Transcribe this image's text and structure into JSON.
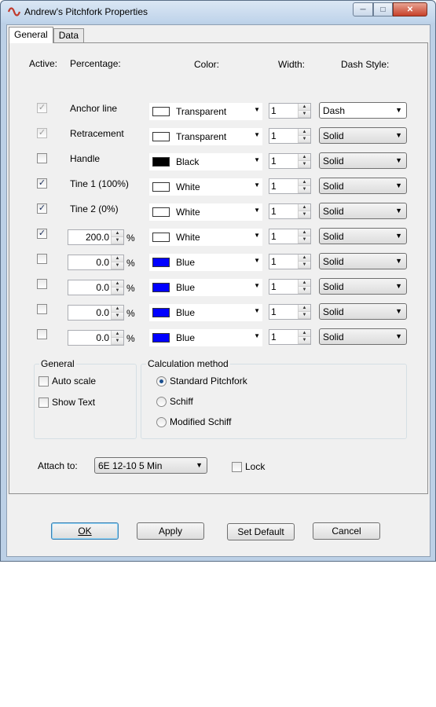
{
  "window": {
    "title": "Andrew's Pitchfork Properties",
    "app_icon": "ninjatrader-logo-icon"
  },
  "tabs": [
    {
      "label": "General",
      "active": true
    },
    {
      "label": "Data",
      "active": false
    }
  ],
  "headers": {
    "active": "Active:",
    "percentage": "Percentage:",
    "color": "Color:",
    "width": "Width:",
    "dash_style": "Dash Style:"
  },
  "rows": [
    {
      "active": true,
      "enabled": false,
      "name": "Anchor line",
      "color": "Transparent",
      "swatch": "#ffffff",
      "width": "1",
      "dash": "Dash"
    },
    {
      "active": true,
      "enabled": false,
      "name": "Retracement",
      "color": "Transparent",
      "swatch": "#ffffff",
      "width": "1",
      "dash": "Solid"
    },
    {
      "active": false,
      "enabled": true,
      "name": "Handle",
      "color": "Black",
      "swatch": "#000000",
      "width": "1",
      "dash": "Solid"
    },
    {
      "active": true,
      "enabled": true,
      "name": "Tine 1 (100%)",
      "color": "White",
      "swatch": "#ffffff",
      "width": "1",
      "dash": "Solid"
    },
    {
      "active": true,
      "enabled": true,
      "name": "Tine 2 (0%)",
      "color": "White",
      "swatch": "#ffffff",
      "width": "1",
      "dash": "Solid"
    },
    {
      "active": true,
      "enabled": true,
      "percent": "200.0",
      "pct_suffix": "%",
      "color": "White",
      "swatch": "#ffffff",
      "width": "1",
      "dash": "Solid"
    },
    {
      "active": false,
      "enabled": true,
      "percent": "0.0",
      "pct_suffix": "%",
      "color": "Blue",
      "swatch": "#0000ff",
      "width": "1",
      "dash": "Solid"
    },
    {
      "active": false,
      "enabled": true,
      "percent": "0.0",
      "pct_suffix": "%",
      "color": "Blue",
      "swatch": "#0000ff",
      "width": "1",
      "dash": "Solid"
    },
    {
      "active": false,
      "enabled": true,
      "percent": "0.0",
      "pct_suffix": "%",
      "color": "Blue",
      "swatch": "#0000ff",
      "width": "1",
      "dash": "Solid"
    },
    {
      "active": false,
      "enabled": true,
      "percent": "0.0",
      "pct_suffix": "%",
      "color": "Blue",
      "swatch": "#0000ff",
      "width": "1",
      "dash": "Solid"
    }
  ],
  "general_group": {
    "title": "General",
    "auto_scale": "Auto scale",
    "show_text": "Show Text"
  },
  "calc_group": {
    "title": "Calculation method",
    "options": [
      "Standard Pitchfork",
      "Schiff",
      "Modified Schiff"
    ],
    "selected": 0
  },
  "attach": {
    "label": "Attach to:",
    "value": "6E 12-10 5 Min"
  },
  "lock": {
    "label": "Lock"
  },
  "buttons": {
    "ok": "OK",
    "apply": "Apply",
    "set_default": "Set Default",
    "cancel": "Cancel"
  },
  "colors": {
    "title_bar": "#bed3ea",
    "close_button": "#c7402a",
    "dialog_bg": "#f0f0f0",
    "radio_dot": "#1b4f8f"
  }
}
